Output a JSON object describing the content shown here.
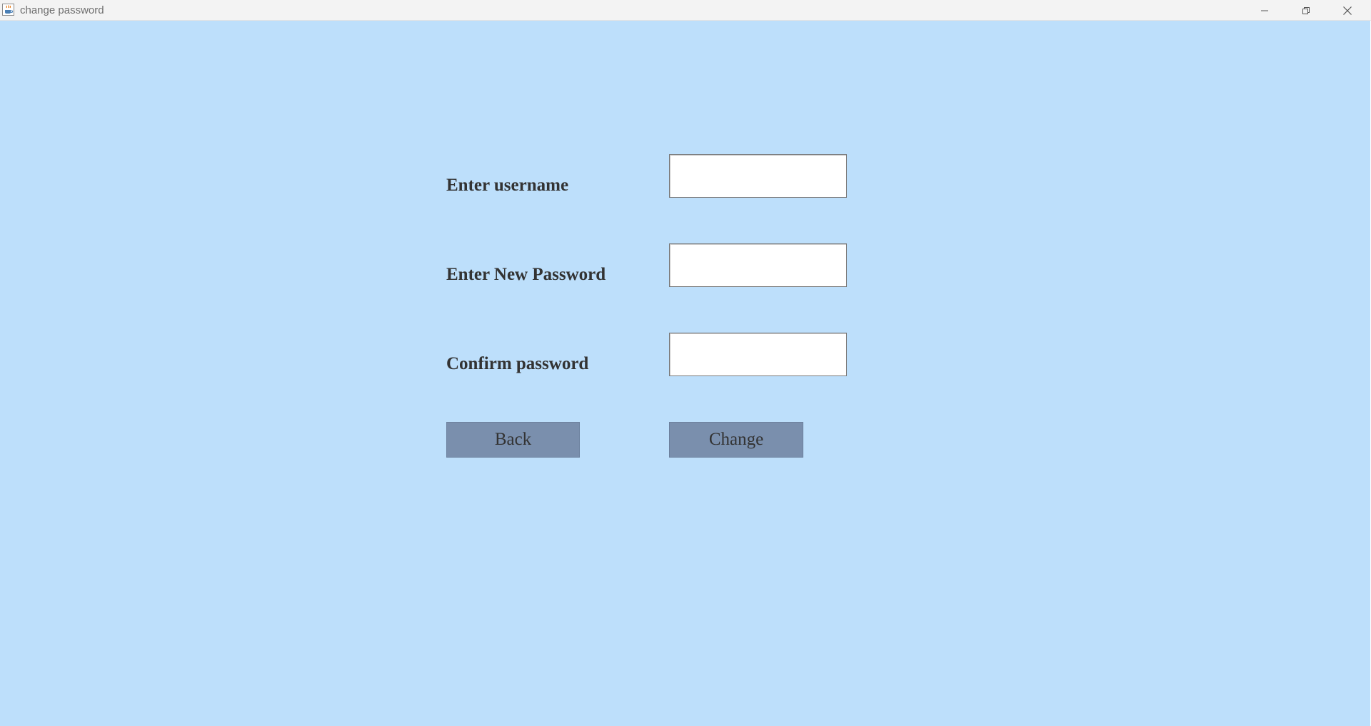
{
  "window": {
    "title": "change password",
    "app_icon": "java-cup-icon",
    "controls": [
      "minimize-icon",
      "restore-icon",
      "close-icon"
    ]
  },
  "form": {
    "username_label": "Enter username",
    "username_value": "",
    "new_password_label": "Enter New Password",
    "new_password_value": "",
    "confirm_password_label": "Confirm password",
    "confirm_password_value": "",
    "back_label": "Back",
    "change_label": "Change"
  },
  "colors": {
    "background": "#bddffb",
    "button": "#7a8fad",
    "text": "#333333",
    "titlebar": "#f3f3f3"
  }
}
